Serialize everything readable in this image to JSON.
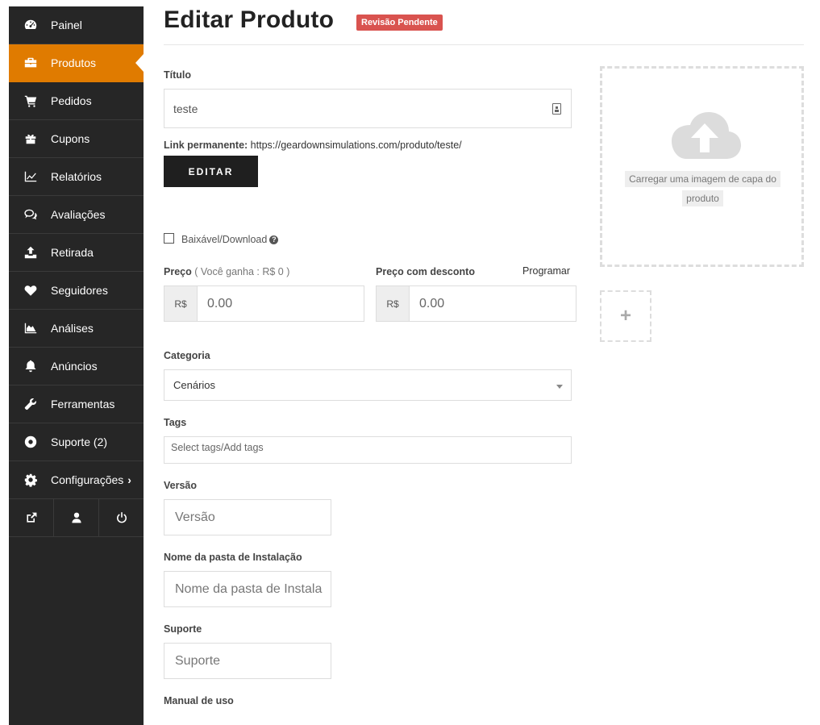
{
  "sidebar": {
    "items": [
      {
        "label": "Painel",
        "icon": "dashboard-icon"
      },
      {
        "label": "Produtos",
        "icon": "briefcase-icon",
        "active": true
      },
      {
        "label": "Pedidos",
        "icon": "cart-icon"
      },
      {
        "label": "Cupons",
        "icon": "gift-icon"
      },
      {
        "label": "Relatórios",
        "icon": "line-chart-icon"
      },
      {
        "label": "Avaliações",
        "icon": "comments-icon"
      },
      {
        "label": "Retirada",
        "icon": "upload-icon"
      },
      {
        "label": "Seguidores",
        "icon": "heart-icon"
      },
      {
        "label": "Análises",
        "icon": "area-chart-icon"
      },
      {
        "label": "Anúncios",
        "icon": "bell-icon"
      },
      {
        "label": "Ferramentas",
        "icon": "wrench-icon"
      },
      {
        "label": "Suporte (2)",
        "icon": "lifebuoy-icon"
      },
      {
        "label": "Configurações",
        "icon": "gear-icon",
        "chevron": "›"
      }
    ],
    "bottom_icons": [
      "external-link-icon",
      "user-icon",
      "power-icon"
    ],
    "active_color": "#e07b00",
    "background": "#262626"
  },
  "header": {
    "title": "Editar Produto",
    "badge": "Revisão Pendente",
    "badge_color": "#d9534f"
  },
  "form": {
    "title_label": "Título",
    "title_value": "teste",
    "permalink_label": "Link permanente:",
    "permalink_url": "https://geardownsimulations.com/produto/teste/",
    "edit_button": "EDITAR",
    "downloadable_label": "Baixável/Download",
    "downloadable_checked": false,
    "price_label": "Preço",
    "price_note": "( Você ganha : R$ 0 )",
    "price_currency": "R$",
    "price_value": "0.00",
    "discount_label": "Preço com desconto",
    "schedule_link": "Programar",
    "discount_currency": "R$",
    "discount_value": "0.00",
    "category_label": "Categoria",
    "category_value": "Cenários",
    "tags_label": "Tags",
    "tags_placeholder": "Select tags/Add tags",
    "version_label": "Versão",
    "version_placeholder": "Versão",
    "install_folder_label": "Nome da pasta de Instalação",
    "install_folder_placeholder": "Nome da pasta de Instala",
    "support_label": "Suporte",
    "support_placeholder": "Suporte",
    "manual_label": "Manual de uso"
  },
  "upload": {
    "cover_text": "Carregar uma imagem de capa do produto",
    "add_gallery": "+"
  }
}
